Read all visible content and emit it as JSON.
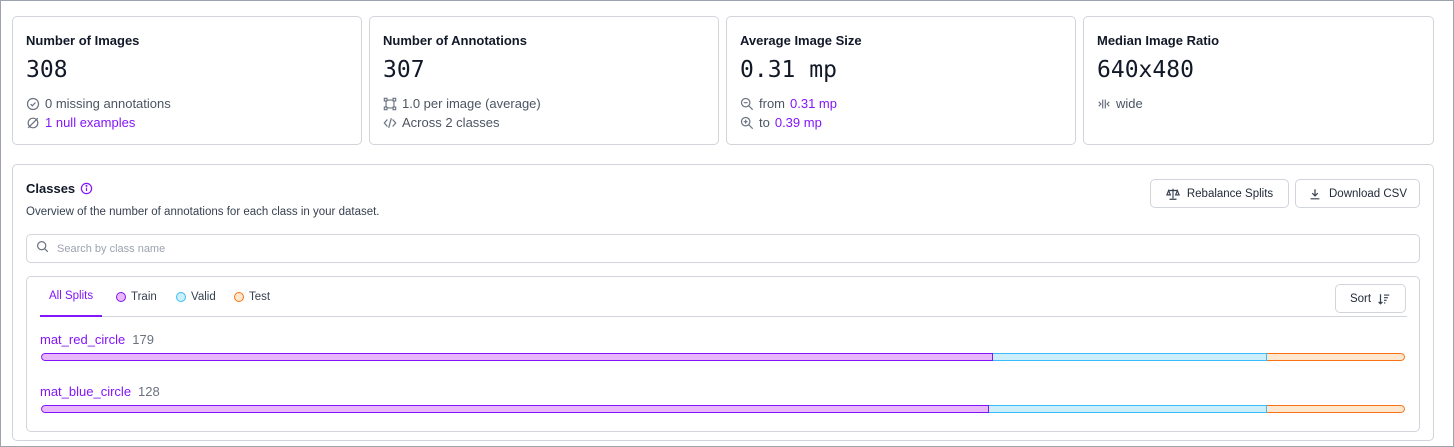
{
  "stats": {
    "images": {
      "title": "Number of Images",
      "value": "308",
      "line1": "0 missing annotations",
      "line2": "1 null examples",
      "line1_icon": "check-circle-icon",
      "line2_icon": "null-set-icon"
    },
    "annotations": {
      "title": "Number of Annotations",
      "value": "307",
      "line1": "1.0 per image (average)",
      "line2": "Across 2 classes",
      "line1_icon": "bounding-box-icon",
      "line2_icon": "code-icon"
    },
    "size": {
      "title": "Average Image Size",
      "value": "0.31 mp",
      "from_prefix": "from",
      "from_value": "0.31 mp",
      "to_prefix": "to",
      "to_value": "0.39 mp",
      "line1_icon": "zoom-out-icon",
      "line2_icon": "zoom-in-icon"
    },
    "ratio": {
      "title": "Median Image Ratio",
      "value": "640x480",
      "line1": "wide",
      "line1_icon": "compress-horizontal-icon"
    }
  },
  "classes": {
    "title": "Classes",
    "subtitle": "Overview of the number of annotations for each class in your dataset.",
    "rebalance_label": "Rebalance Splits",
    "download_label": "Download CSV",
    "search_placeholder": "Search by class name",
    "tabs": {
      "all": "All Splits",
      "train": "Train",
      "valid": "Valid",
      "test": "Test"
    },
    "sort_label": "Sort",
    "items": [
      {
        "name": "mat_red_circle",
        "count": "179",
        "split_fractions": {
          "train": 0.698,
          "valid": 0.201,
          "test": 0.101
        }
      },
      {
        "name": "mat_blue_circle",
        "count": "128",
        "split_fractions": {
          "train": 0.695,
          "valid": 0.204,
          "test": 0.101
        }
      }
    ]
  },
  "colors": {
    "accent": "#8315f9",
    "train": "#e8b8fb",
    "valid": "#cdeefb",
    "test": "#fde7cf"
  }
}
